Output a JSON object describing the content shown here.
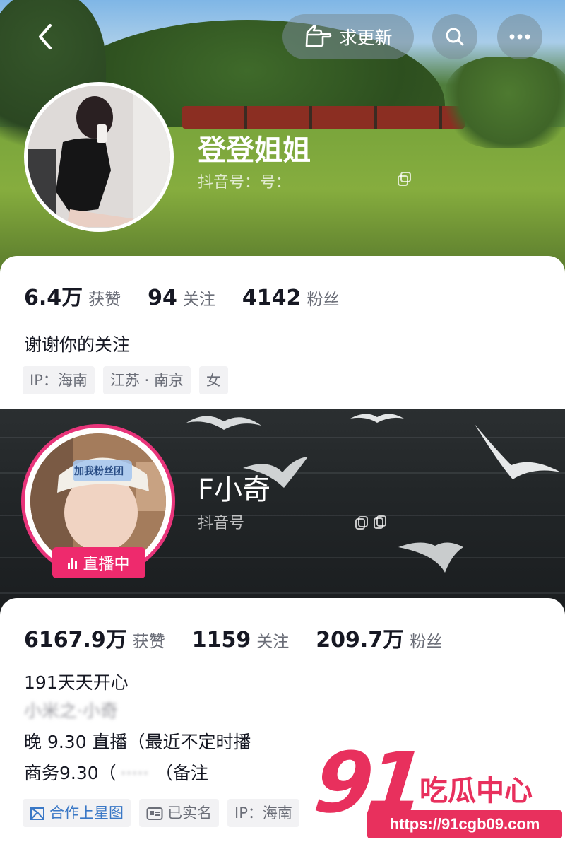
{
  "profile1": {
    "header": {
      "request_update_label": "求更新"
    },
    "name": "登登姐姐",
    "douyin_id": "抖音号：号：",
    "stats": [
      {
        "value": "6.4万",
        "label": "获赞"
      },
      {
        "value": "94",
        "label": "关注"
      },
      {
        "value": "4142",
        "label": "粉丝"
      }
    ],
    "bio": "谢谢你的关注",
    "tags": [
      "IP：海南",
      "江苏 · 南京",
      "女"
    ]
  },
  "profile2": {
    "name": "F小奇",
    "douyin_id": "抖音号",
    "live_label": "直播中",
    "avatar_sign_text": "加我粉丝团",
    "stats": [
      {
        "value": "6167.9万",
        "label": "获赞"
      },
      {
        "value": "1159",
        "label": "关注"
      },
      {
        "value": "209.7万",
        "label": "粉丝"
      }
    ],
    "bio": {
      "line1": "191天天开心",
      "line2_blurred": "小米之·小奇",
      "line3": "晚 9.30 直播（最近不定时播",
      "line4_prefix": "商务9.30（",
      "line4_blurred": "·····",
      "line4_suffix": "（备注"
    },
    "tags": {
      "star": "合作上星图",
      "verified": "已实名",
      "ip": "IP：海南"
    }
  },
  "watermark": {
    "number": "91",
    "title": "吃瓜中心",
    "url": "https://91cgb09.com"
  },
  "colors": {
    "live_pink": "#ee2a6d",
    "watermark_red": "#e8305d",
    "star_blue": "#3a78c6"
  }
}
